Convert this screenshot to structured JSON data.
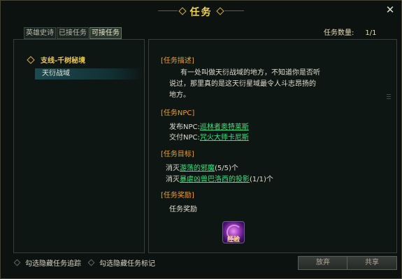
{
  "window": {
    "title": "任务",
    "close_icon": "close-icon"
  },
  "tabs": [
    {
      "label": "英雄史诗",
      "active": false
    },
    {
      "label": "已接任务",
      "active": false
    },
    {
      "label": "可接任务",
      "active": true
    }
  ],
  "task_count": {
    "label": "任务数量:",
    "value": "1/1"
  },
  "tree": {
    "parent": {
      "label": "支线-千树秘境",
      "icon": "diamond-icon"
    },
    "child": {
      "label": "天衍战域",
      "selected": true
    }
  },
  "detail": {
    "desc_header": "[任务描述]",
    "desc_lines": [
      "有一处叫做天衍战域的地方，不知道你是否听",
      "说过，那里真的是这天衍星域最令人斗志昂扬的",
      "地方。"
    ],
    "npc_header": "[任务NPC]",
    "issuer_label": "发布NPC:",
    "issuer_name": "巡林者奥特莱斯",
    "submit_label": "交付NPC:",
    "submit_name": "咒火大师卡尼斯",
    "goal_header": "[任务目标]",
    "goal1_prefix": "消灭",
    "goal1_target": "游荡的邪魔",
    "goal1_progress": "(5/5)个",
    "goal2_prefix": "消灭",
    "goal2_target": "暴虐凶兽巴洛西的投影",
    "goal2_progress": "(1/1)个",
    "reward_header": "[任务奖励]",
    "reward_label": "任务奖励",
    "reward_item_label": "经验",
    "reward_item_icon": "experience-orb-icon"
  },
  "footer": {
    "hide_tracking_label": "勾选隐藏任务追踪",
    "hide_marker_label": "勾选隐藏任务标记",
    "abandon_label": "放弃",
    "share_label": "共享"
  },
  "colors": {
    "accent_gold": "#f0d060",
    "section_orange": "#e8a030",
    "npc_green": "#40e080",
    "panel_border": "#34403a"
  }
}
